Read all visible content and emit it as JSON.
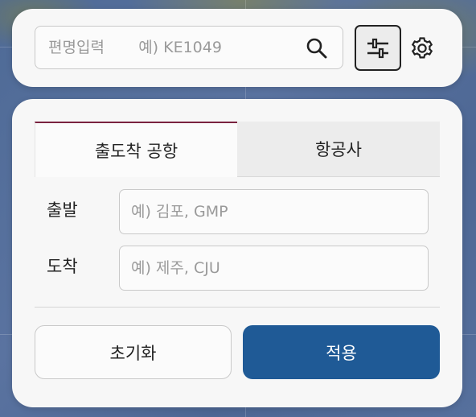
{
  "search": {
    "placeholder": "편명입력       예) KE1049",
    "value": ""
  },
  "icons": {
    "search": "search-icon",
    "filter": "sliders-icon",
    "settings": "gear-icon"
  },
  "tabs": [
    {
      "label": "출도착 공항",
      "active": true
    },
    {
      "label": "항공사",
      "active": false
    }
  ],
  "form": {
    "departure": {
      "label": "출발",
      "placeholder": "예) 김포, GMP",
      "value": ""
    },
    "arrival": {
      "label": "도착",
      "placeholder": "예) 제주, CJU",
      "value": ""
    }
  },
  "actions": {
    "reset_label": "초기화",
    "apply_label": "적용"
  },
  "colors": {
    "accent": "#1f5a96",
    "active_tab_border": "#7a2340"
  }
}
